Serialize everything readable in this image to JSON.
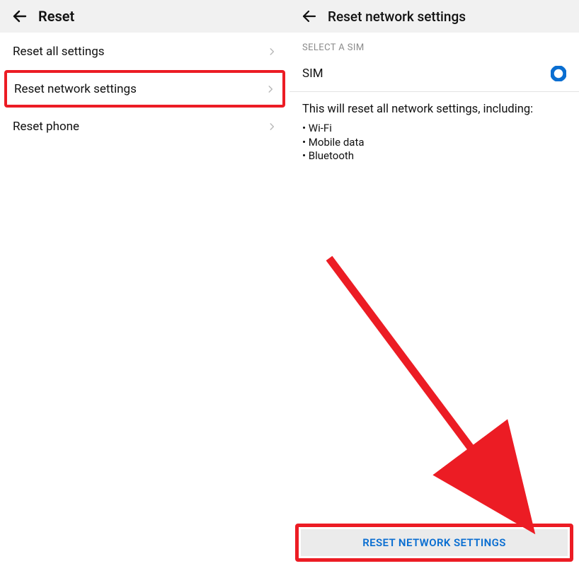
{
  "left": {
    "title": "Reset",
    "items": [
      {
        "label": "Reset all settings"
      },
      {
        "label": "Reset network settings"
      },
      {
        "label": "Reset phone"
      }
    ]
  },
  "right": {
    "title": "Reset network settings",
    "section_label": "SELECT A SIM",
    "sim_label": "SIM",
    "description": "This will reset all network settings, including:",
    "bullets": [
      "Wi-Fi",
      "Mobile data",
      "Bluetooth"
    ],
    "button_label": "RESET NETWORK SETTINGS"
  }
}
